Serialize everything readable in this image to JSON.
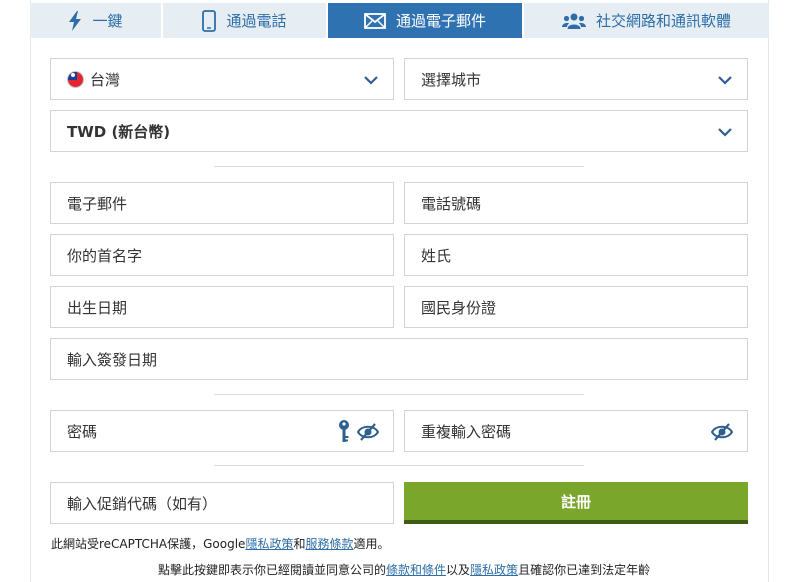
{
  "tabs": [
    {
      "label": "一鍵",
      "icon": "lightning-icon"
    },
    {
      "label": "通過電話",
      "icon": "phone-icon"
    },
    {
      "label": "通過電子郵件",
      "icon": "envelope-icon",
      "active": true
    },
    {
      "label": "社交網路和通訊軟體",
      "icon": "users-icon"
    }
  ],
  "form": {
    "country": "台灣",
    "city_placeholder": "選擇城市",
    "currency": "TWD (新台幣)",
    "email_placeholder": "電子郵件",
    "phone_placeholder": "電話號碼",
    "first_name_placeholder": "你的首名字",
    "last_name_placeholder": "姓氏",
    "birthdate_placeholder": "出生日期",
    "national_id_placeholder": "國民身份證",
    "issue_date_placeholder": "輸入簽發日期",
    "password_placeholder": "密碼",
    "repeat_password_placeholder": "重複輸入密碼",
    "promo_placeholder": "輸入促銷代碼（如有）",
    "register_label": "註冊"
  },
  "recaptcha_note": {
    "prefix": "此網站受reCAPTCHA保護，Google",
    "privacy_link": "隱私政策",
    "and": "和",
    "terms_link": "服務條款",
    "suffix": "適用。"
  },
  "consent_note": {
    "prefix": "點擊此按鍵即表示你已經閱讀並同意公司的",
    "terms_link": "條款和條件",
    "middle": "以及",
    "privacy_link": "隱私政策",
    "suffix": "且確認你已達到法定年齡"
  },
  "colors": {
    "tab_active": "#2f72b1",
    "tab_inactive": "#e6edf3",
    "link": "#2d6ea8",
    "register_button": "#7aa62c"
  }
}
